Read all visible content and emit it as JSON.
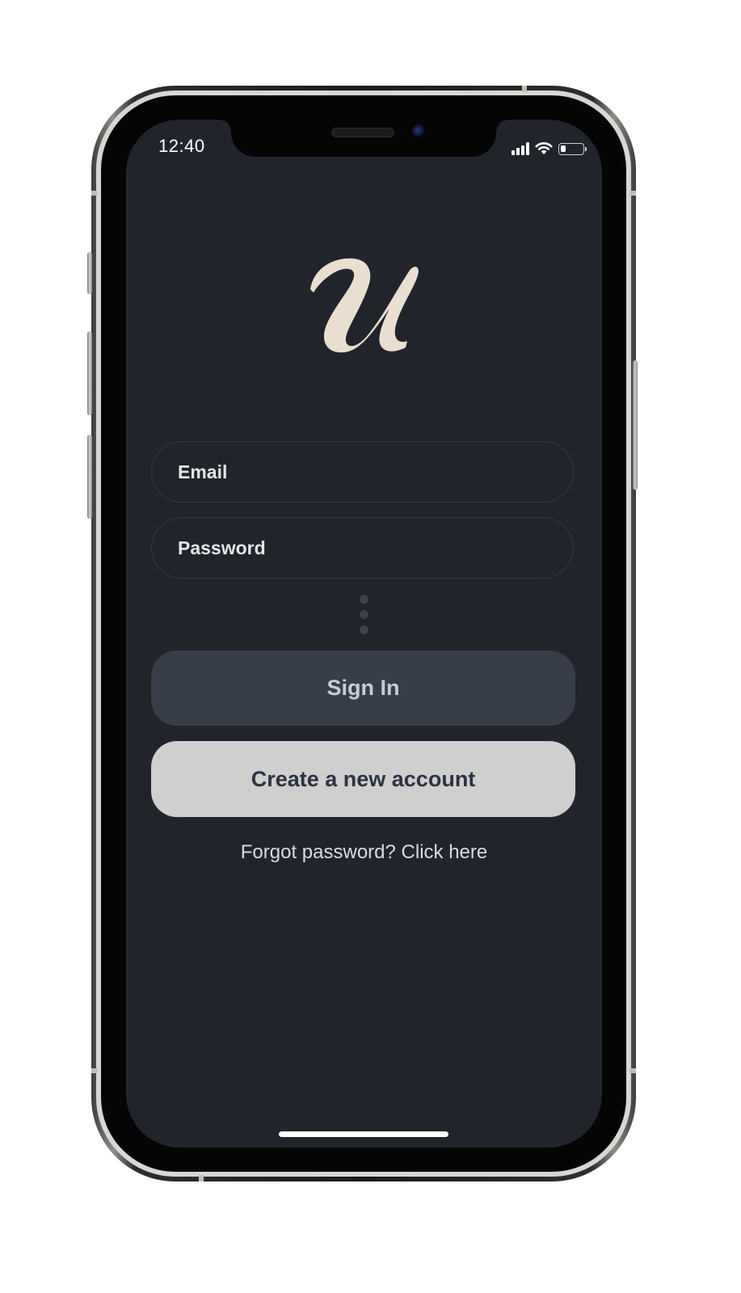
{
  "status_bar": {
    "time": "12:40",
    "signal_icon": "cellular-signal-icon",
    "wifi_icon": "wifi-icon",
    "battery_icon": "battery-icon",
    "battery_level": 0.25
  },
  "app": {
    "logo_glyph": "U",
    "logo_color": "#e9ded0",
    "background_color": "#21242b"
  },
  "login_form": {
    "email_placeholder": "Email",
    "password_placeholder": "Password",
    "signin_label": "Sign In",
    "create_account_label": "Create a new account",
    "forgot_password_text": "Forgot password? Click here"
  },
  "colors": {
    "signin_button": "#383d4a",
    "create_button": "#cfcfcf",
    "field_border": "#343944"
  }
}
